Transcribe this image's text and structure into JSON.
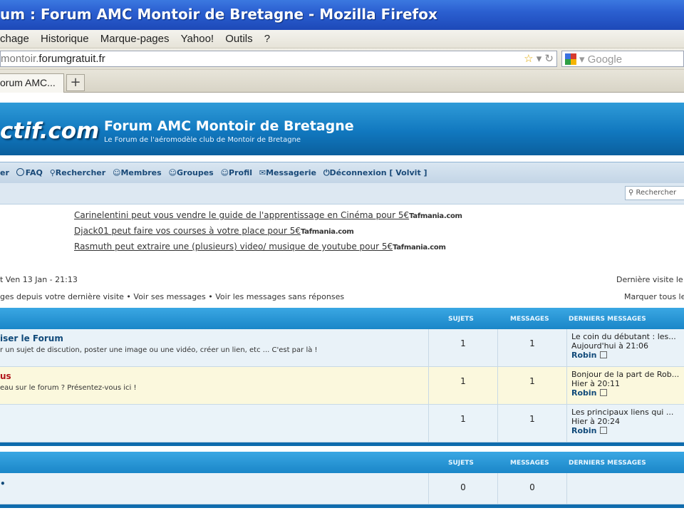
{
  "window": {
    "title": "um : Forum AMC Montoir de Bretagne - Mozilla Firefox"
  },
  "menu": [
    "chage",
    "Historique",
    "Marque-pages",
    "Yahoo!",
    "Outils",
    "?"
  ],
  "address": {
    "url_dim": "montoir.",
    "url_main": "forumgratuit.fr"
  },
  "search_engine": {
    "placeholder": "Google"
  },
  "tabs": [
    {
      "label": "orum AMC..."
    }
  ],
  "tab_add_label": "+",
  "forum": {
    "logo": "ctif.com",
    "title": "Forum AMC Montoir de Bretagne",
    "subtitle": "Le Forum de l'aéromodèle club de Montoir de Bretagne",
    "nav": [
      {
        "label": "er",
        "icon": ""
      },
      {
        "label": "FAQ",
        "icon": "question-icon"
      },
      {
        "label": "Rechercher",
        "icon": "magnifier-icon"
      },
      {
        "label": "Membres",
        "icon": "user-icon"
      },
      {
        "label": "Groupes",
        "icon": "group-icon"
      },
      {
        "label": "Profil",
        "icon": "profile-icon"
      },
      {
        "label": "Messagerie",
        "icon": "envelope-icon"
      },
      {
        "label": "Déconnexion [ Volvit ]",
        "icon": "power-icon"
      }
    ],
    "search_placeholder": "Rechercher",
    "ads": [
      {
        "text": "Carinelentini peut vous vendre le guide de l'apprentissage en Cinéma pour 5€",
        "brand": "Tafmania.com"
      },
      {
        "text": "Djack01 peut faire vos courses à votre place pour 5€",
        "brand": "Tafmania.com"
      },
      {
        "text": "Rasmuth peut extraire une (plusieurs) video/ musique de youtube pour 5€",
        "brand": "Tafmania.com"
      }
    ],
    "last_visit_left": "t Ven 13 Jan - 21:13",
    "last_visit_right": "Dernière visite le",
    "links_left": "ges depuis votre dernière visite • Voir ses messages • Voir les messages sans réponses",
    "links_right": "Marquer tous le",
    "headers": {
      "sujets": "SUJETS",
      "messages": "MESSAGES",
      "derniers": "DERNIERS MESSAGES"
    },
    "category1_rows": [
      {
        "title": "iser le Forum",
        "title_red": false,
        "desc": "r un sujet de discution, poster une image ou une vidéo, créer un lien, etc ... C'est par là !",
        "sujets": "1",
        "messages": "1",
        "last_title": "Le coin du débutant : les...",
        "last_date": "Aujourd'hui à 21:06",
        "last_author": "Robin"
      },
      {
        "title": "us",
        "title_red": true,
        "desc": "eau sur le forum ? Présentez-vous ici !",
        "sujets": "1",
        "messages": "1",
        "last_title": "Bonjour de la part de Rob...",
        "last_date": "Hier à 20:11",
        "last_author": "Robin"
      },
      {
        "title": "",
        "title_red": false,
        "desc": "",
        "sujets": "1",
        "messages": "1",
        "last_title": "Les principaux liens qui ...",
        "last_date": "Hier à 20:24",
        "last_author": "Robin"
      }
    ],
    "category2_rows": [
      {
        "title": "•",
        "sujets": "0",
        "messages": "0"
      }
    ]
  }
}
